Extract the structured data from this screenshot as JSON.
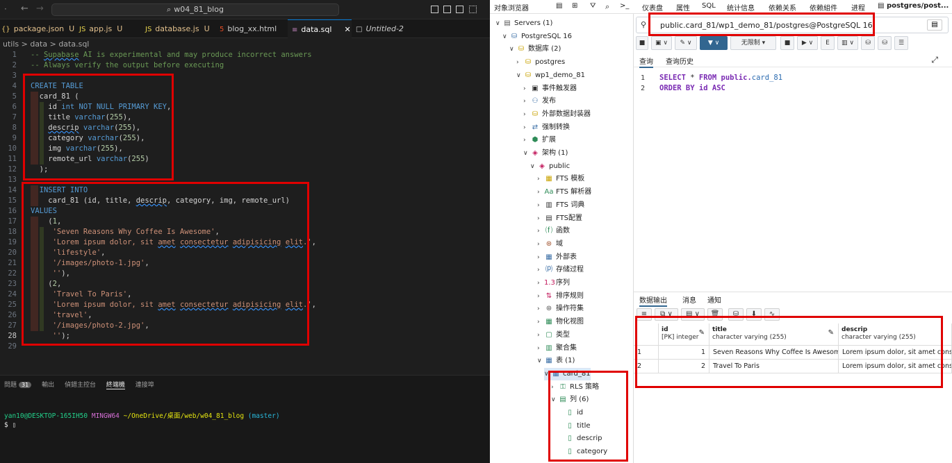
{
  "vscode": {
    "search": "w04_81_blog",
    "tabs": [
      {
        "label": "package.json",
        "mod": "U",
        "icon": "{}"
      },
      {
        "label": "app.js",
        "mod": "U",
        "icon": "JS"
      },
      {
        "label": "database.js",
        "mod": "U",
        "icon": "JS"
      },
      {
        "label": "blog_xx.html",
        "mod": "",
        "icon": "5"
      },
      {
        "label": "data.sql",
        "mod": "",
        "icon": "≡"
      },
      {
        "label": "Untitled-2",
        "mod": "",
        "icon": "□"
      }
    ],
    "breadcrumb": "utils > data > data.sql",
    "code_lines": [
      "1",
      "2",
      "3",
      "4",
      "5",
      "6",
      "7",
      "8",
      "9",
      "10",
      "11",
      "12",
      "13",
      "14",
      "15",
      "16",
      "17",
      "18",
      "19",
      "20",
      "21",
      "22",
      "23",
      "24",
      "25",
      "26",
      "27",
      "28",
      "29"
    ],
    "panel": {
      "tabs": [
        "問題",
        "輸出",
        "偵錯主控台",
        "終端機",
        "連接埠"
      ],
      "problems_count": "31",
      "terminal_user": "yan10@DESKTOP-165IH50",
      "terminal_env": "MINGW64",
      "terminal_path": "~/OneDrive/桌面/web/w04_81_blog",
      "terminal_branch": "(master)",
      "terminal_prompt": "$"
    }
  },
  "pgadmin": {
    "menubar": [
      "对象浏览器",
      "仪表盘",
      "属性",
      "SQL",
      "统计信息",
      "依赖关系",
      "依赖組件",
      "进程",
      "postgres/post..."
    ],
    "tree": [
      {
        "label": "Servers (1)",
        "depth": 0,
        "arrow": "∨"
      },
      {
        "label": "PostgreSQL 16",
        "depth": 1,
        "arrow": "∨"
      },
      {
        "label": "数据库 (2)",
        "depth": 2,
        "arrow": "∨"
      },
      {
        "label": "postgres",
        "depth": 3,
        "arrow": ">"
      },
      {
        "label": "wp1_demo_81",
        "depth": 3,
        "arrow": "∨"
      },
      {
        "label": "事件触发器",
        "depth": 4,
        "arrow": ">"
      },
      {
        "label": "发布",
        "depth": 4,
        "arrow": ">"
      },
      {
        "label": "外部数据封装器",
        "depth": 4,
        "arrow": ">"
      },
      {
        "label": "强制转换",
        "depth": 4,
        "arrow": ">"
      },
      {
        "label": "扩展",
        "depth": 4,
        "arrow": ">"
      },
      {
        "label": "架构 (1)",
        "depth": 4,
        "arrow": "∨"
      },
      {
        "label": "public",
        "depth": 5,
        "arrow": "∨"
      },
      {
        "label": "FTS 模板",
        "depth": 6,
        "arrow": ">"
      },
      {
        "label": "FTS 解析器",
        "depth": 6,
        "arrow": ">"
      },
      {
        "label": "FTS 词典",
        "depth": 6,
        "arrow": ">"
      },
      {
        "label": "FTS配置",
        "depth": 6,
        "arrow": ">"
      },
      {
        "label": "函数",
        "depth": 6,
        "arrow": ">"
      },
      {
        "label": "域",
        "depth": 6,
        "arrow": ">"
      },
      {
        "label": "外部表",
        "depth": 6,
        "arrow": ">"
      },
      {
        "label": "存储过程",
        "depth": 6,
        "arrow": ">"
      },
      {
        "label": "序列",
        "depth": 6,
        "arrow": ">"
      },
      {
        "label": "排序规则",
        "depth": 6,
        "arrow": ">"
      },
      {
        "label": "操作符集",
        "depth": 6,
        "arrow": ">"
      },
      {
        "label": "物化视图",
        "depth": 6,
        "arrow": ">"
      },
      {
        "label": "类型",
        "depth": 6,
        "arrow": ">"
      },
      {
        "label": "聚合集",
        "depth": 6,
        "arrow": ">"
      },
      {
        "label": "表 (1)",
        "depth": 6,
        "arrow": "∨"
      },
      {
        "label": "card_81",
        "depth": 7,
        "arrow": "∨"
      },
      {
        "label": "RLS 策略",
        "depth": 8,
        "arrow": ">"
      },
      {
        "label": "列 (6)",
        "depth": 8,
        "arrow": "∨"
      },
      {
        "label": "id",
        "depth": 9,
        "arrow": ""
      },
      {
        "label": "title",
        "depth": 9,
        "arrow": ""
      },
      {
        "label": "descrip",
        "depth": 9,
        "arrow": ""
      },
      {
        "label": "category",
        "depth": 9,
        "arrow": ""
      }
    ],
    "connection": "public.card_81/wp1_demo_81/postgres@PostgreSQL 16",
    "limit_label": "无限制",
    "query_tabs": [
      "查询",
      "查询历史"
    ],
    "sql_line1_kw1": "SELECT",
    "sql_line1_star": " * ",
    "sql_line1_kw2": "FROM",
    "sql_line1_schema": " public.",
    "sql_line1_table": "card_81",
    "sql_line2_kw1": "ORDER BY",
    "sql_line2_col": " id ",
    "sql_line2_kw2": "ASC",
    "output_tabs": [
      "数据输出",
      "消息",
      "通知"
    ],
    "grid": {
      "columns": [
        {
          "name": "id",
          "type": "[PK] integer"
        },
        {
          "name": "title",
          "type": "character varying (255)"
        },
        {
          "name": "descrip",
          "type": "character varying (255)"
        }
      ],
      "rows": [
        {
          "n": "1",
          "id": "1",
          "title": "Seven Reasons Why Coffee Is Awesome",
          "descrip": "Lorem ipsum dolor, sit amet consectetur adipisicing elit."
        },
        {
          "n": "2",
          "id": "2",
          "title": "Travel To Paris",
          "descrip": "Lorem ipsum dolor, sit amet consectetur adipisicing elit."
        }
      ]
    }
  },
  "colors": {
    "highlight": "#e00000",
    "pg_blue": "#326690",
    "vscode_bg": "#1e1e1e"
  }
}
